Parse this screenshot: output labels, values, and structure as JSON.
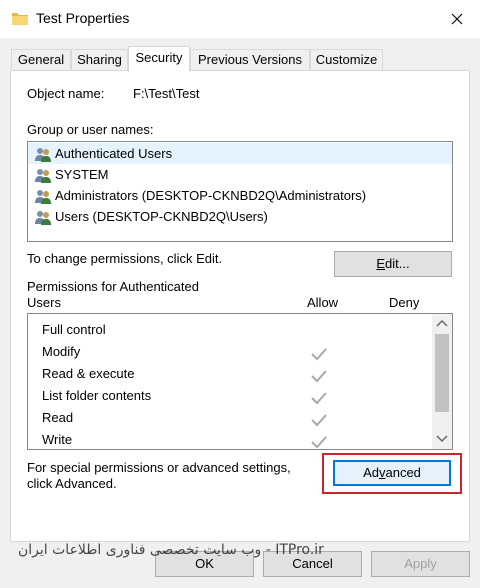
{
  "window": {
    "title": "Test Properties",
    "close_glyph": "✕"
  },
  "tabs": [
    {
      "label": "General"
    },
    {
      "label": "Sharing"
    },
    {
      "label": "Security"
    },
    {
      "label": "Previous Versions"
    },
    {
      "label": "Customize"
    }
  ],
  "object": {
    "label": "Object name:",
    "value": "F:\\Test\\Test"
  },
  "group_section": {
    "label": "Group or user names:",
    "items": [
      {
        "name": "Authenticated Users",
        "selected": true
      },
      {
        "name": "SYSTEM",
        "selected": false
      },
      {
        "name": "Administrators (DESKTOP-CKNBD2Q\\Administrators)",
        "selected": false
      },
      {
        "name": "Users (DESKTOP-CKNBD2Q\\Users)",
        "selected": false
      }
    ]
  },
  "edit": {
    "hint": "To change permissions, click Edit.",
    "button_pre": "",
    "button_accel": "E",
    "button_post": "dit..."
  },
  "permissions": {
    "title_line1": "Permissions for Authenticated",
    "title_line2": "Users",
    "col_allow": "Allow",
    "col_deny": "Deny",
    "items": [
      {
        "name": "Full control",
        "allow": false,
        "deny": false
      },
      {
        "name": "Modify",
        "allow": true,
        "deny": false
      },
      {
        "name": "Read & execute",
        "allow": true,
        "deny": false
      },
      {
        "name": "List folder contents",
        "allow": true,
        "deny": false
      },
      {
        "name": "Read",
        "allow": true,
        "deny": false
      },
      {
        "name": "Write",
        "allow": true,
        "deny": false
      }
    ]
  },
  "advanced": {
    "hint_line1": "For special permissions or advanced settings,",
    "hint_line2": "click Advanced.",
    "button_pre": "Ad",
    "button_accel": "v",
    "button_post": "anced",
    "highlight_color": "#c9252b"
  },
  "footer": {
    "ok": "OK",
    "cancel": "Cancel",
    "apply": "Apply",
    "watermark": "وب سایت تخصصی فناوری اطلاعات ایران - ITPro.ir"
  }
}
